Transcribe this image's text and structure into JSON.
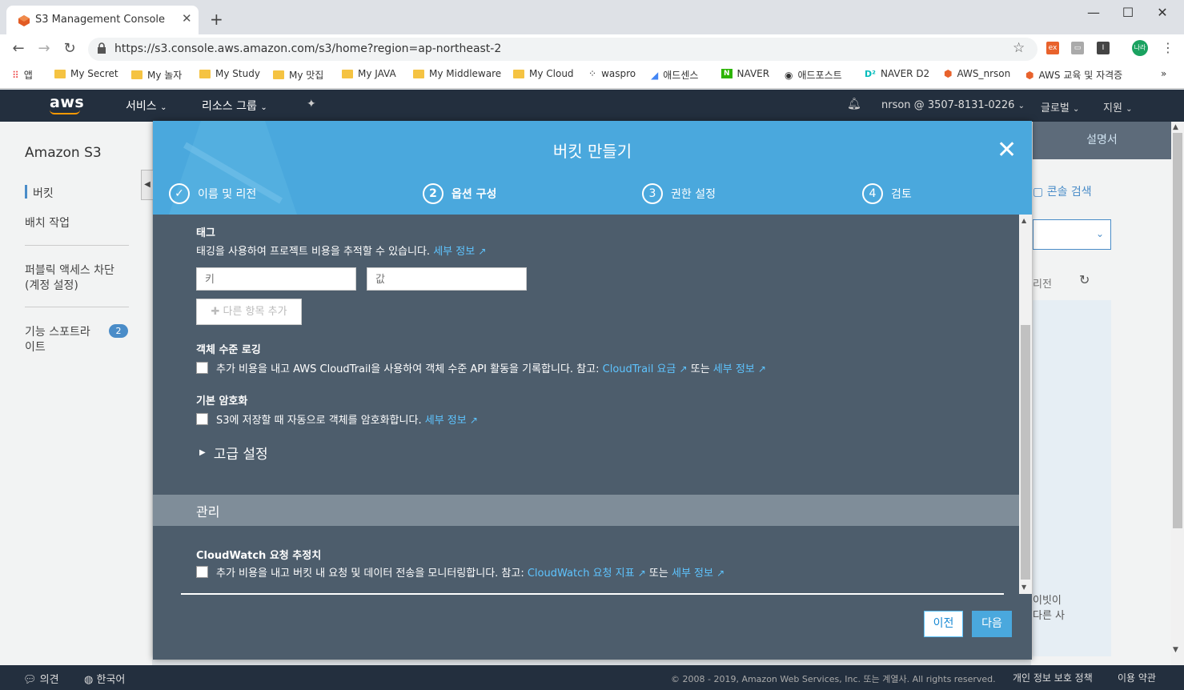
{
  "browser": {
    "tab_title": "S3 Management Console",
    "new_tab": "+",
    "url": "https://s3.console.aws.amazon.com/s3/home?region=ap-northeast-2",
    "profile": "나라",
    "bookmarks": [
      "앱",
      "My Secret",
      "My 놀자",
      "My Study",
      "My 맛집",
      "My JAVA",
      "My Middleware",
      "My Cloud",
      "waspro",
      "애드센스",
      "NAVER",
      "애드포스트",
      "NAVER D2",
      "AWS_nrson",
      "AWS 교육 및 자격증"
    ],
    "more": "»"
  },
  "awsnav": {
    "logo": "aws",
    "services": "서비스",
    "resource_groups": "리소스 그룹",
    "account": "nrson @ 3507-8131-0226",
    "global": "글로벌",
    "support": "지원"
  },
  "sidebar": {
    "title": "Amazon S3",
    "items": [
      "버킷",
      "배치 작업",
      "퍼블릭 액세스 차단",
      "(계정 설정)",
      "기능 스포트라",
      "이트"
    ],
    "badge": "2"
  },
  "right_panel": {
    "docs": "설명서",
    "console_search": "콘솔 검색",
    "region_partial": "리전",
    "text1": "이빗이",
    "text2": "다른 사"
  },
  "modal": {
    "title": "버킷 만들기",
    "close": "✕",
    "steps": [
      {
        "num": "✓",
        "label": "이름 및 리전"
      },
      {
        "num": "2",
        "label": "옵션 구성"
      },
      {
        "num": "3",
        "label": "권한 설정"
      },
      {
        "num": "4",
        "label": "검토"
      }
    ],
    "tags": {
      "title": "태그",
      "desc": "태깅을 사용하여 프로젝트 비용을 추적할 수 있습니다.",
      "link": "세부 정보",
      "key_placeholder": "키",
      "value_placeholder": "값",
      "add": "다른 항목 추가"
    },
    "logging": {
      "title": "객체 수준 로깅",
      "desc": "추가 비용을 내고 AWS CloudTrail을 사용하여 객체 수준 API 활동을 기록합니다. 참고:",
      "link1": "CloudTrail 요금",
      "or": "또는",
      "link2": "세부 정보"
    },
    "encryption": {
      "title": "기본 암호화",
      "desc": "S3에 저장할 때 자동으로 객체를 암호화합니다.",
      "link": "세부 정보"
    },
    "advanced": "고급 설정",
    "management": "관리",
    "cloudwatch": {
      "title": "CloudWatch 요청 추정치",
      "desc": "추가 비용을 내고 버킷 내 요청 및 데이터 전송을 모니터링합니다. 참고:",
      "link1": "CloudWatch 요청 지표",
      "or": "또는",
      "link2": "세부 정보"
    },
    "prev": "이전",
    "next": "다음"
  },
  "footer": {
    "feedback": "의견",
    "language": "한국어",
    "copyright": "© 2008 - 2019, Amazon Web Services, Inc. 또는 계열사. All rights reserved.",
    "privacy": "개인 정보 보호 정책",
    "terms": "이용 약관"
  },
  "colors": {
    "aws_nav": "#232f3e",
    "modal_header": "#4aa8dd",
    "modal_body": "#4d5d6c",
    "link": "#5ec4ff",
    "aws_orange": "#ff9900"
  }
}
